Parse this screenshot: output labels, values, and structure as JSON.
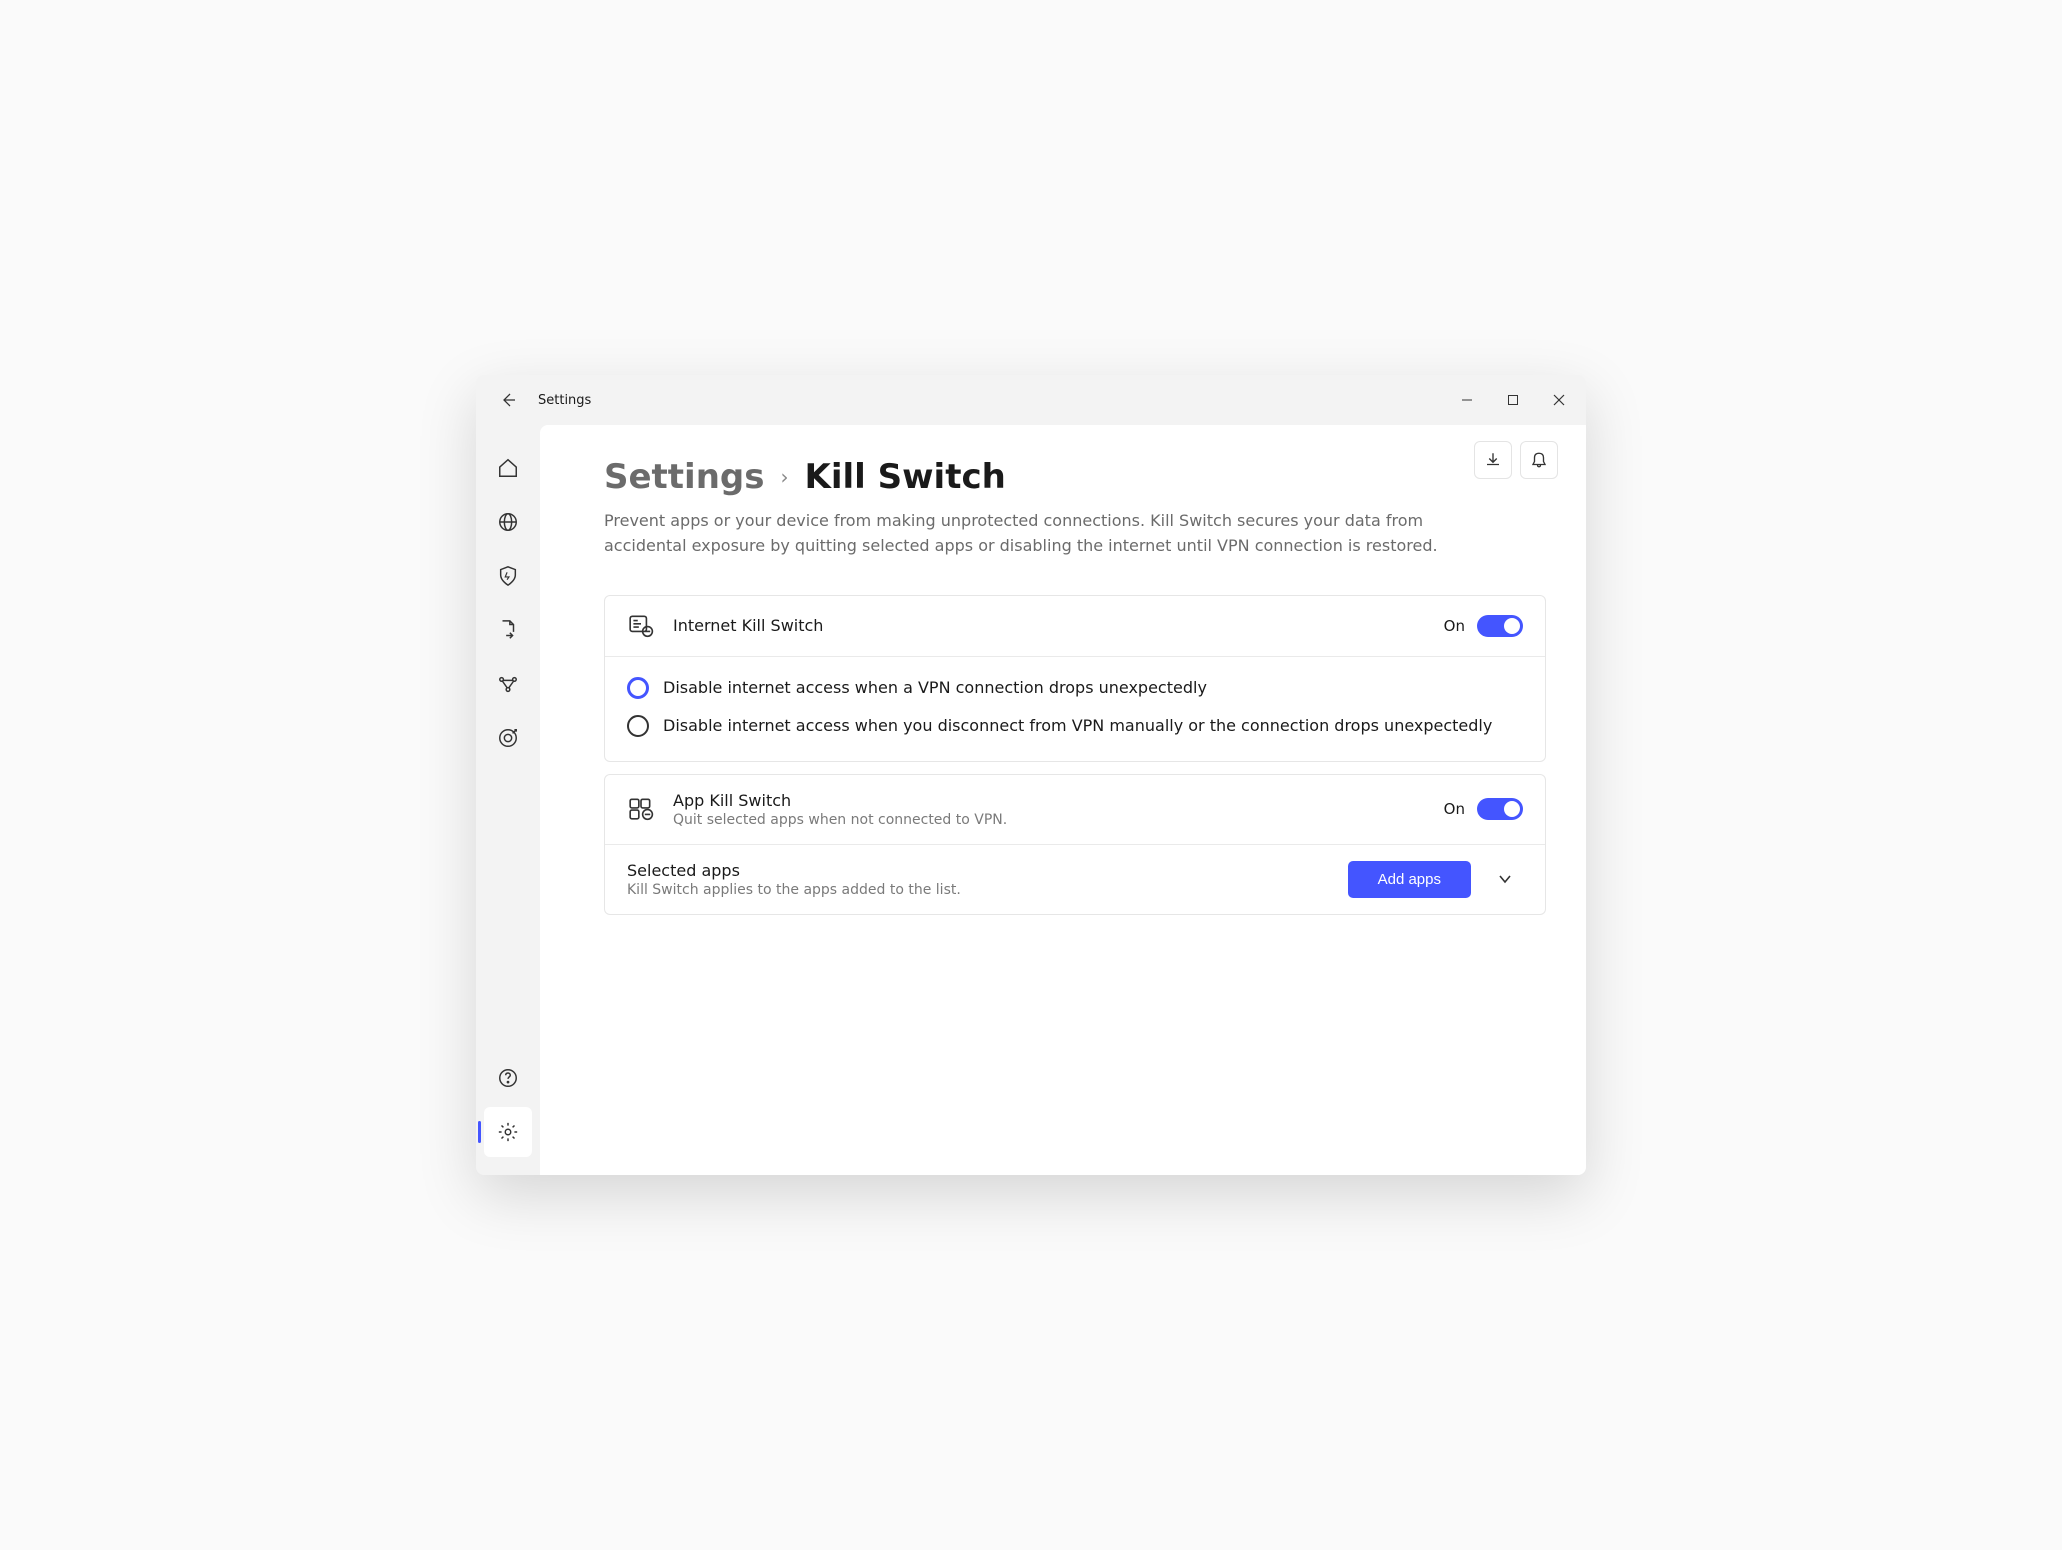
{
  "window": {
    "title": "Settings"
  },
  "breadcrumb": {
    "parent": "Settings",
    "separator": "›",
    "leaf": "Kill Switch"
  },
  "description": "Prevent apps or your device from making unprotected connections. Kill Switch secures your data from accidental exposure by quitting selected apps or disabling the internet until VPN connection is restored.",
  "internetKillSwitch": {
    "title": "Internet Kill Switch",
    "toggleState": "On",
    "options": [
      {
        "label": "Disable internet access when a VPN connection drops unexpectedly",
        "selected": true
      },
      {
        "label": "Disable internet access when you disconnect from VPN manually or the connection drops unexpectedly",
        "selected": false
      }
    ]
  },
  "appKillSwitch": {
    "title": "App Kill Switch",
    "subtitle": "Quit selected apps when not connected to VPN.",
    "toggleState": "On"
  },
  "selectedApps": {
    "title": "Selected apps",
    "subtitle": "Kill Switch applies to the apps added to the list.",
    "button": "Add apps"
  }
}
